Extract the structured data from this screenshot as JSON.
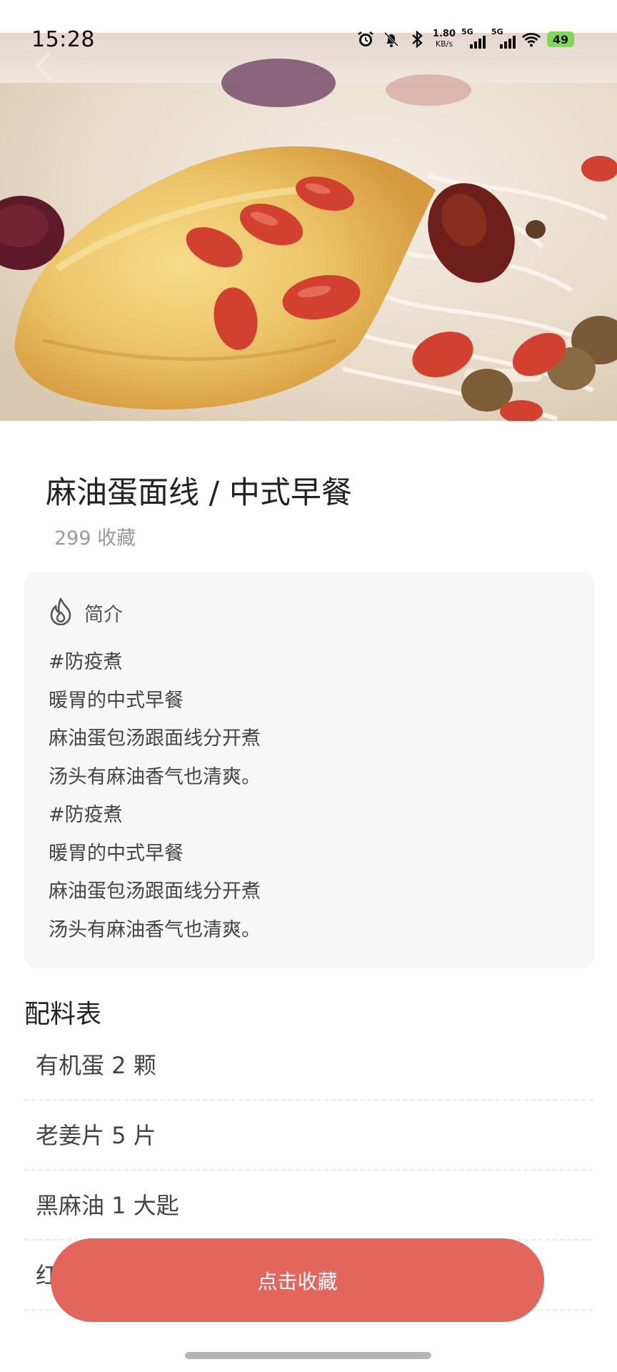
{
  "status_bar": {
    "time": "15:28",
    "net_speed_value": "1.80",
    "net_speed_unit": "KB/s",
    "signal1_label": "5G",
    "signal2_label": "5G",
    "battery": "49",
    "icons": [
      "alarm-icon",
      "bell-muted-icon",
      "bluetooth-icon",
      "wifi-icon"
    ]
  },
  "recipe": {
    "title": "麻油蛋面线 / 中式早餐",
    "favorites": "299 收藏"
  },
  "intro": {
    "label": "简介",
    "icon": "flame-icon",
    "lines": [
      "#防疫煮",
      "暖胃的中式早餐",
      "麻油蛋包汤跟面线分开煮",
      "汤头有麻油香气也清爽。",
      "#防疫煮",
      "暖胃的中式早餐",
      "麻油蛋包汤跟面线分开煮",
      "汤头有麻油香气也清爽。"
    ]
  },
  "ingredients": {
    "title": "配料表",
    "items": [
      "有机蛋 2 颗",
      "老姜片 5 片",
      "黑麻油 1 大匙",
      "红"
    ]
  },
  "actions": {
    "collect_label": "点击收藏"
  },
  "colors": {
    "accent": "#e2665b",
    "card_bg": "#f7f7f7"
  }
}
